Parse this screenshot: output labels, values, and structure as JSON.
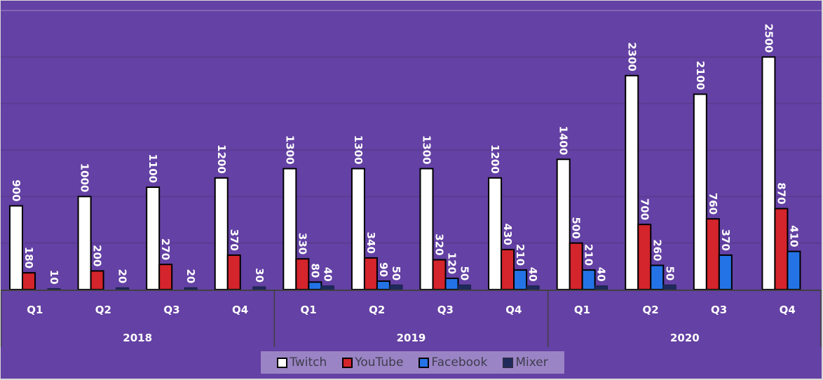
{
  "chart_data": {
    "type": "bar",
    "title": "",
    "xlabel": "",
    "ylabel": "",
    "ylim": [
      0,
      3000
    ],
    "gridlines": [
      500,
      1000,
      1500,
      2000,
      2500,
      3000
    ],
    "grid": true,
    "legend_position": "bottom",
    "background": "#6441a4",
    "years": [
      {
        "label": "2018",
        "quarters": [
          "Q1",
          "Q2",
          "Q3",
          "Q4"
        ]
      },
      {
        "label": "2019",
        "quarters": [
          "Q1",
          "Q2",
          "Q3",
          "Q4"
        ]
      },
      {
        "label": "2020",
        "quarters": [
          "Q1",
          "Q2",
          "Q3",
          "Q4"
        ]
      }
    ],
    "categories": [
      "2018 Q1",
      "2018 Q2",
      "2018 Q3",
      "2018 Q4",
      "2019 Q1",
      "2019 Q2",
      "2019 Q3",
      "2019 Q4",
      "2020 Q1",
      "2020 Q2",
      "2020 Q3",
      "2020 Q4"
    ],
    "series": [
      {
        "name": "Twitch",
        "color": "#ffffff",
        "values": [
          900,
          1000,
          1100,
          1200,
          1300,
          1300,
          1300,
          1200,
          1400,
          2300,
          2100,
          2500
        ]
      },
      {
        "name": "YouTube",
        "color": "#d4242c",
        "values": [
          180,
          200,
          270,
          370,
          330,
          340,
          320,
          430,
          500,
          700,
          760,
          870
        ]
      },
      {
        "name": "Facebook",
        "color": "#2473e6",
        "values": [
          null,
          null,
          null,
          null,
          80,
          90,
          120,
          210,
          210,
          260,
          370,
          410
        ]
      },
      {
        "name": "Mixer",
        "color": "#1f2a5c",
        "values": [
          10,
          20,
          20,
          30,
          40,
          50,
          50,
          40,
          40,
          50,
          null,
          null
        ]
      }
    ]
  },
  "legend": [
    {
      "name": "Twitch"
    },
    {
      "name": "YouTube"
    },
    {
      "name": "Facebook"
    },
    {
      "name": "Mixer"
    }
  ]
}
